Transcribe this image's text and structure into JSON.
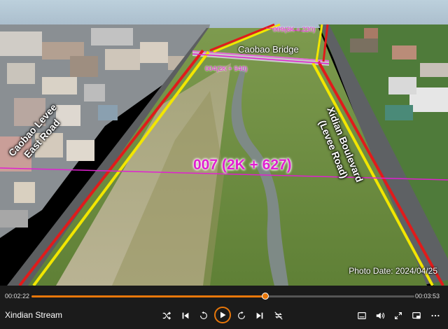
{
  "video": {
    "overlay": {
      "bridge_label": "Caobao Bridge",
      "marker_009": "009(3K + 230)",
      "marker_004": "004(2K + 940)",
      "marker_007": "007 (2K + 627)",
      "road_left_line1": "Caobao Levee",
      "road_left_line2": "East Road",
      "road_right_line1": "Xidian Boulevard",
      "road_right_line2": "(Levee Road)",
      "photo_date": "Photo Date: 2024/04/25"
    }
  },
  "player": {
    "title": "Xindian Stream",
    "current_time": "00:02:22",
    "total_time": "00:03:53",
    "progress": 0.61,
    "accent_color": "#e8770a",
    "icons": {
      "shuffle": "shuffle-icon",
      "previous": "skip-previous-icon",
      "rewind": "replay-10-icon",
      "play": "play-icon",
      "forward": "forward-30-icon",
      "next": "skip-next-icon",
      "repeat_off": "repeat-off-icon",
      "subtitles": "subtitles-icon",
      "volume": "volume-icon",
      "fullscreen": "fullscreen-icon",
      "cast": "cast-icon",
      "more": "more-icon"
    }
  }
}
